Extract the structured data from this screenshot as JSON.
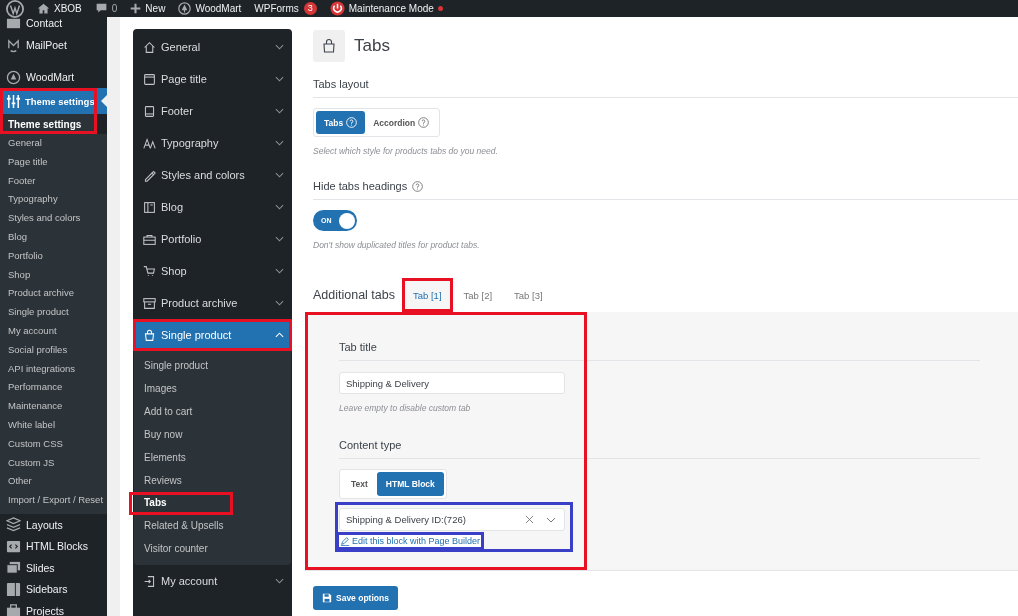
{
  "admin_bar": {
    "site": "XBOB",
    "comments": "0",
    "new": "New",
    "theme": "WoodMart",
    "forms": "WPForms",
    "forms_badge": "3",
    "maintenance": "Maintenance Mode"
  },
  "wp_menu": {
    "top": [
      {
        "label": "Contact"
      },
      {
        "label": "MailPoet"
      },
      {
        "label": "WoodMart"
      }
    ],
    "current": {
      "label": "Theme settings",
      "submenu_title": "Theme settings",
      "highlighted": true,
      "submenu": [
        "General",
        "Page title",
        "Footer",
        "Typography",
        "Styles and colors",
        "Blog",
        "Portfolio",
        "Shop",
        "Product archive",
        "Single product",
        "My account",
        "Social profiles",
        "API integrations",
        "Performance",
        "Maintenance",
        "White label",
        "Custom CSS",
        "Custom JS",
        "Other",
        "Import / Export / Reset"
      ]
    },
    "bottom": [
      {
        "label": "Layouts"
      },
      {
        "label": "HTML Blocks"
      },
      {
        "label": "Slides"
      },
      {
        "label": "Sidebars"
      },
      {
        "label": "Projects"
      }
    ]
  },
  "settings_nav": [
    {
      "label": "General",
      "expanded": false
    },
    {
      "label": "Page title",
      "expanded": false
    },
    {
      "label": "Footer",
      "expanded": false
    },
    {
      "label": "Typography",
      "expanded": false
    },
    {
      "label": "Styles and colors",
      "expanded": false
    },
    {
      "label": "Blog",
      "expanded": false
    },
    {
      "label": "Portfolio",
      "expanded": false
    },
    {
      "label": "Shop",
      "expanded": false
    },
    {
      "label": "Product archive",
      "expanded": false
    },
    {
      "label": "Single product",
      "expanded": true,
      "highlighted": true,
      "children": [
        {
          "label": "Single product",
          "selected": false
        },
        {
          "label": "Images",
          "selected": false
        },
        {
          "label": "Add to cart",
          "selected": false
        },
        {
          "label": "Buy now",
          "selected": false
        },
        {
          "label": "Elements",
          "selected": false
        },
        {
          "label": "Reviews",
          "selected": false
        },
        {
          "label": "Tabs",
          "selected": true,
          "highlighted": true
        },
        {
          "label": "Related & Upsells",
          "selected": false
        },
        {
          "label": "Visitor counter",
          "selected": false
        }
      ]
    },
    {
      "label": "My account",
      "expanded": false
    }
  ],
  "page": {
    "title": "Tabs",
    "tabs_layout": {
      "label": "Tabs layout",
      "options": [
        {
          "label": "Tabs",
          "selected": true
        },
        {
          "label": "Accordion",
          "selected": false
        }
      ],
      "hint": "Select which style for products tabs do you need."
    },
    "hide_headings": {
      "label": "Hide tabs headings",
      "on": true,
      "state_label": "ON",
      "hint": "Don't show duplicated titles for product tabs."
    },
    "additional_tabs": {
      "label": "Additional tabs",
      "tabs": [
        {
          "label": "Tab [1]",
          "selected": true,
          "highlighted": true
        },
        {
          "label": "Tab [2]",
          "selected": false
        },
        {
          "label": "Tab [3]",
          "selected": false
        }
      ],
      "panel_highlighted": true,
      "tab_title": {
        "label": "Tab title",
        "value": "Shipping & Delivery",
        "hint": "Leave empty to disable custom tab"
      },
      "content_type": {
        "label": "Content type",
        "options": [
          {
            "label": "Text",
            "selected": false
          },
          {
            "label": "HTML Block",
            "selected": true
          }
        ],
        "block_select": {
          "value": "Shipping & Delivery ID:(726)",
          "highlighted": true
        },
        "edit_link": {
          "label": "Edit this block with Page Builder",
          "highlighted": true
        }
      }
    },
    "save": "Save options"
  }
}
